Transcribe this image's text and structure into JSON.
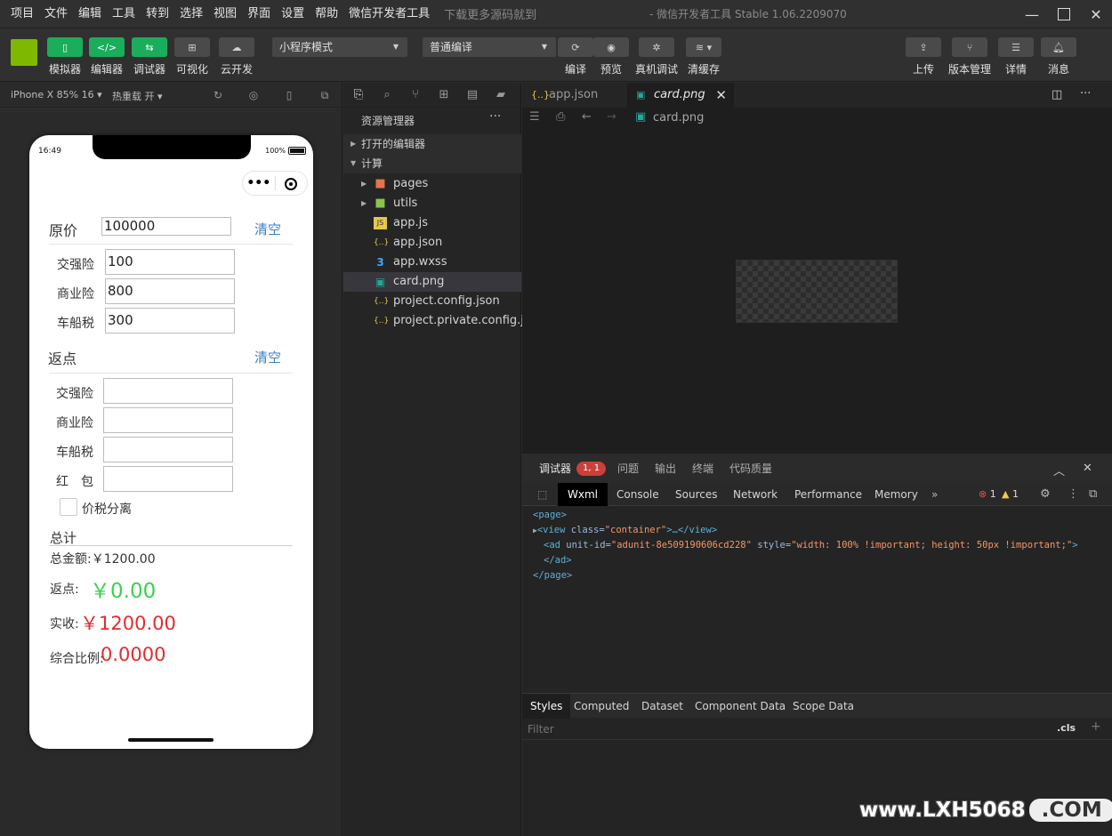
{
  "menu": {
    "items": [
      "项目",
      "文件",
      "编辑",
      "工具",
      "转到",
      "选择",
      "视图",
      "界面",
      "设置",
      "帮助",
      "微信开发者工具"
    ],
    "hint": "下载更多源码就到",
    "window_title": "- 微信开发者工具 Stable 1.06.2209070"
  },
  "toolbar": {
    "simulator": "模拟器",
    "editor": "编辑器",
    "debugger": "调试器",
    "visual": "可视化",
    "cloud": "云开发",
    "mode_select": "小程序模式",
    "compile_select": "普通编译",
    "compile": "编译",
    "preview": "预览",
    "remote_debug": "真机调试",
    "clear_cache": "清缓存",
    "upload": "上传",
    "version": "版本管理",
    "details": "详情",
    "messages": "消息"
  },
  "simbar": {
    "device": "iPhone X 85% 16 ▾",
    "hot_reload": "热重载 开 ▾"
  },
  "phone": {
    "time": "16:49",
    "battery": "100%",
    "price_label": "原价",
    "price_value": "100000",
    "clear_1": "清空",
    "fields_1": [
      {
        "label": "交强险",
        "value": "100"
      },
      {
        "label": "商业险",
        "value": "800"
      },
      {
        "label": "车船税",
        "value": "300"
      }
    ],
    "rebate_label": "返点",
    "clear_2": "清空",
    "fields_2": [
      {
        "label": "交强险",
        "value": ""
      },
      {
        "label": "商业险",
        "value": ""
      },
      {
        "label": "车船税",
        "value": ""
      },
      {
        "label": "红　包",
        "value": ""
      }
    ],
    "tax_sep": "价税分离",
    "total_title": "总计",
    "total_amount": "总金额:￥1200.00",
    "rebate_text": "返点:",
    "rebate_value": "￥0.00",
    "actual_text": "实收:",
    "actual_value": "￥1200.00",
    "ratio_text": "综合比例:",
    "ratio_value": "0.0000"
  },
  "explorer": {
    "title": "资源管理器",
    "open_editors": "打开的编辑器",
    "project": "计算",
    "files": [
      {
        "name": "pages",
        "icon": "▪",
        "color": "#e8734a",
        "folder": true
      },
      {
        "name": "utils",
        "icon": "▪",
        "color": "#8bc34a",
        "folder": true
      },
      {
        "name": "app.js",
        "icon": "JS",
        "color": "#e6c84a",
        "folder": false
      },
      {
        "name": "app.json",
        "icon": "{..}",
        "color": "#e6c84a",
        "folder": false
      },
      {
        "name": "app.wxss",
        "icon": "3",
        "color": "#42a5f5",
        "folder": false
      },
      {
        "name": "card.png",
        "icon": "▣",
        "color": "#26a69a",
        "folder": false
      },
      {
        "name": "project.config.json",
        "icon": "{..}",
        "color": "#e6c84a",
        "folder": false
      },
      {
        "name": "project.private.config.js...",
        "icon": "{..}",
        "color": "#e6c84a",
        "folder": false
      }
    ]
  },
  "editor": {
    "tab_1": "app.json",
    "tab_2": "card.png",
    "breadcrumb": "card.png"
  },
  "debugger": {
    "tab_debugger": "调试器",
    "badge": "1, 1",
    "tab_issues": "问题",
    "tab_output": "输出",
    "tab_terminal": "终端",
    "tab_quality": "代码质量",
    "dev_tabs": [
      "Wxml",
      "Console",
      "Sources",
      "Network",
      "Performance",
      "Memory"
    ],
    "errors": "1",
    "warnings": "1",
    "style_tabs": [
      "Styles",
      "Computed",
      "Dataset",
      "Component Data",
      "Scope Data"
    ],
    "filter_placeholder": "Filter",
    "cls": ".cls"
  },
  "code": {
    "l1": "<page>",
    "l2_tag": "<view",
    "l2_attr": " class=",
    "l2_val": "\"container\"",
    "l2_rest": ">…</view>",
    "l3_tag": "<ad",
    "l3_attr1": " unit-id=",
    "l3_val1": "\"adunit-8e509190606cd228\"",
    "l3_attr2": " style=",
    "l3_val2": "\"width: 100% !important; height: 50px !important;\"",
    "l3_end": ">",
    "l4": "</ad>",
    "l5": "</page>"
  },
  "watermark": {
    "main": "www.LXH5068",
    "tld": ".COM"
  }
}
